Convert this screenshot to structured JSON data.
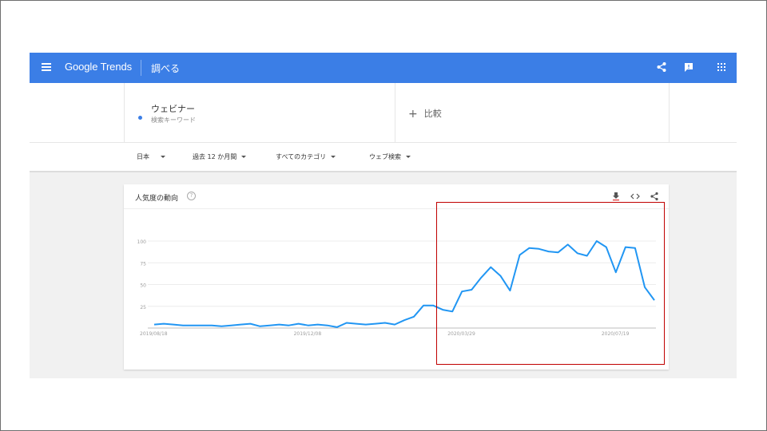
{
  "app": {
    "brand": "Google Trends",
    "explore_label": "調べる",
    "icons": [
      "menu-icon",
      "share-icon",
      "feedback-icon",
      "apps-icon"
    ]
  },
  "search": {
    "term": "ウェビナー",
    "term_type": "検索キーワード",
    "compare_label": "比較",
    "term_color": "#3b7ee6"
  },
  "filters": {
    "region": "日本",
    "time": "過去 12 か月間",
    "category": "すべてのカテゴリ",
    "property": "ウェブ検索"
  },
  "card": {
    "title": "人気度の動向",
    "help": "?",
    "icons": [
      "download-icon",
      "embed-icon",
      "share-icon"
    ]
  },
  "chart_data": {
    "type": "line",
    "title": "人気度の動向",
    "xlabel": "",
    "ylabel": "",
    "ylim": [
      0,
      100
    ],
    "yticks": [
      25,
      50,
      75,
      100
    ],
    "grid": true,
    "x_tick_labels": [
      "2019/08/18",
      "2019/12/08",
      "2020/03/29",
      "2020/07/19"
    ],
    "x_tick_positions": [
      0,
      16,
      32,
      48
    ],
    "series": [
      {
        "color": "#2196f3",
        "values": [
          4,
          5,
          4,
          3,
          3,
          3,
          3,
          2,
          3,
          4,
          5,
          2,
          3,
          4,
          3,
          5,
          3,
          4,
          3,
          1,
          6,
          5,
          4,
          5,
          6,
          4,
          9,
          13,
          26,
          26,
          21,
          19,
          42,
          44,
          58,
          70,
          60,
          43,
          84,
          92,
          91,
          88,
          87,
          96,
          86,
          83,
          100,
          93,
          64,
          93,
          92,
          47,
          32
        ]
      }
    ]
  },
  "annotation": {
    "highlight_color": "#c00000"
  }
}
